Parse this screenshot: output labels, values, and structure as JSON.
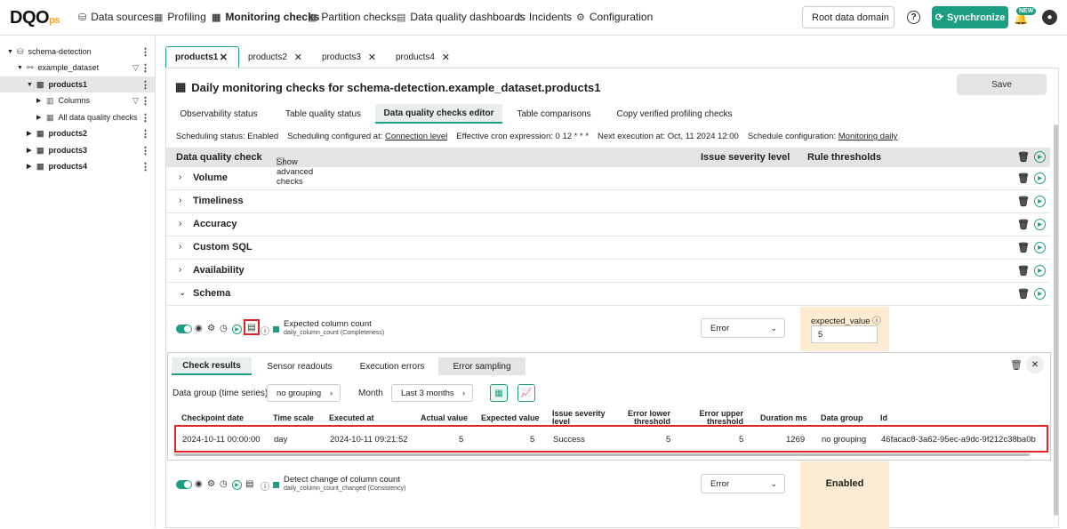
{
  "app": {
    "logo": "DQO",
    "logo_suffix": "ps"
  },
  "nav": [
    {
      "label": "Data sources",
      "icon": "data-sources-icon",
      "glyph": "⛁"
    },
    {
      "label": "Profiling",
      "icon": "profiling-icon",
      "glyph": "▦"
    },
    {
      "label": "Monitoring checks",
      "icon": "monitoring-icon",
      "glyph": "▦"
    },
    {
      "label": "Partition checks",
      "icon": "partition-icon",
      "glyph": "▦"
    },
    {
      "label": "Data quality dashboards",
      "icon": "dashboard-icon",
      "glyph": "▤"
    },
    {
      "label": "Incidents",
      "icon": "incidents-icon",
      "glyph": "⚠"
    },
    {
      "label": "Configuration",
      "icon": "gear-icon",
      "glyph": "⚙"
    }
  ],
  "header": {
    "root_domain": "Root data domain",
    "help": "?",
    "sync_label": "Synchronize",
    "new_badge": "NEW",
    "user_initial": "●"
  },
  "tree": [
    {
      "label": "schema-detection",
      "level": 0
    },
    {
      "label": "example_dataset",
      "level": 1
    },
    {
      "label": "products1",
      "level": 2
    },
    {
      "label": "Columns",
      "level": 3
    },
    {
      "label": "All data quality checks",
      "level": 3
    },
    {
      "label": "products2",
      "level": 2
    },
    {
      "label": "products3",
      "level": 2
    },
    {
      "label": "products4",
      "level": 2
    }
  ],
  "tabs": [
    "products1",
    "products2",
    "products3",
    "products4"
  ],
  "main": {
    "title": "Daily monitoring checks for schema-detection.example_dataset.products1",
    "save": "Save"
  },
  "subtabs": [
    "Observability status",
    "Table quality status",
    "Data quality checks editor",
    "Table comparisons",
    "Copy verified profiling checks"
  ],
  "schedule": {
    "status_label": "Scheduling status:",
    "status": "Enabled",
    "configured_label": "Scheduling configured at:",
    "configured": "Connection level",
    "cron_label": "Effective cron expression:",
    "cron": "0 12 * * *",
    "next_label": "Next execution at:",
    "next": "Oct, 11 2024 12:00",
    "config_label": "Schedule configuration:",
    "config": "Monitoring daily"
  },
  "table_header": {
    "check": "Data quality check",
    "advanced": "Show advanced checks",
    "severity": "Issue severity level",
    "thresholds": "Rule thresholds"
  },
  "categories": [
    "Volume",
    "Timeliness",
    "Accuracy",
    "Custom SQL",
    "Availability",
    "Schema"
  ],
  "checks": [
    {
      "name": "Expected column count",
      "sub": "daily_column_count (Completeness)",
      "severity": "Error",
      "threshold_label": "expected_value",
      "threshold_value": "5"
    },
    {
      "name": "Detect change of column count",
      "sub": "daily_column_count_changed (Consistency)",
      "severity": "Error",
      "threshold_label": "Enabled"
    }
  ],
  "panel": {
    "tabs": [
      "Check results",
      "Sensor readouts",
      "Execution errors",
      "Error sampling"
    ],
    "group_label": "Data group (time series)",
    "group_value": "no grouping",
    "month_label": "Month",
    "month_value": "Last 3 months",
    "columns": [
      "Checkpoint date",
      "Time scale",
      "Executed at",
      "Actual value",
      "Expected value",
      "Issue severity level",
      "Error lower threshold",
      "Error upper threshold",
      "Duration ms",
      "Data group",
      "Id"
    ],
    "row": {
      "checkpoint": "2024-10-11 00:00:00",
      "scale": "day",
      "executed": "2024-10-11 09:21:52",
      "actual": "5",
      "expected": "5",
      "severity": "Success",
      "lower": "5",
      "upper": "5",
      "duration": "1269",
      "group": "no grouping",
      "id": "46facac8-3a62-95ec-a9dc-9f212c38ba0b"
    }
  },
  "colors": {
    "accent": "#1b9e82",
    "highlight": "#e0262b",
    "threshold_bg": "#fdecd2"
  }
}
